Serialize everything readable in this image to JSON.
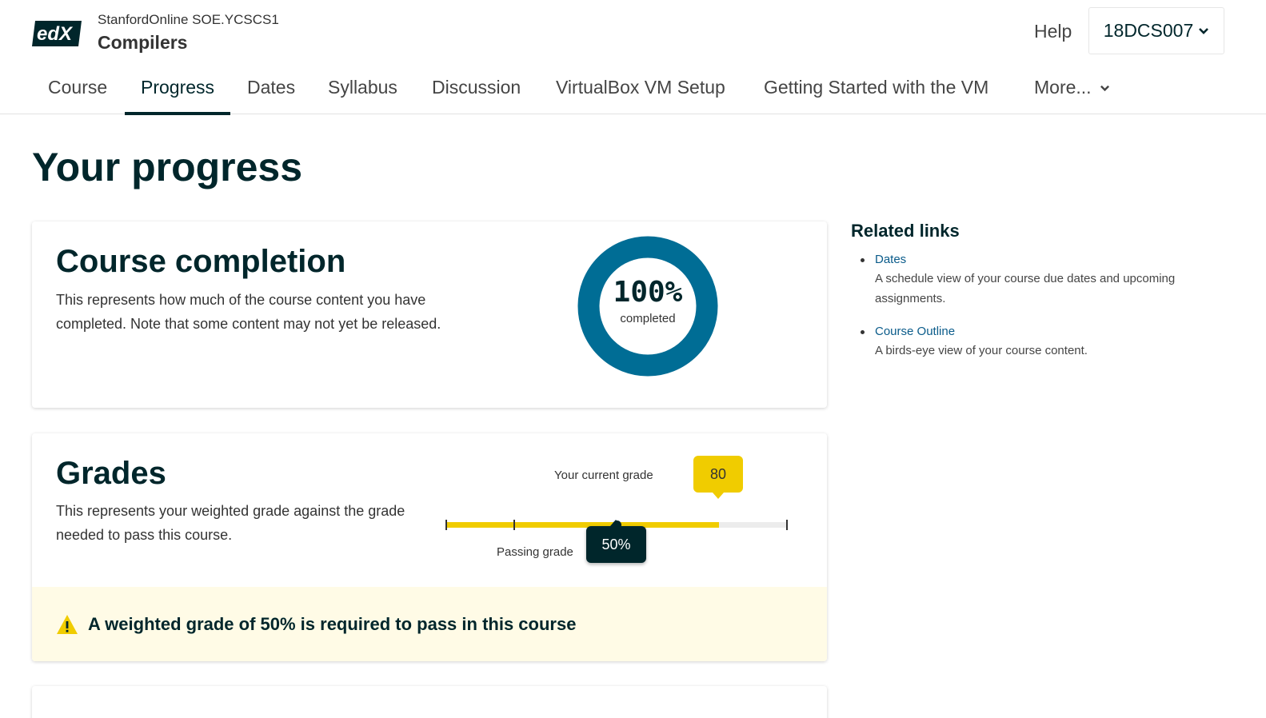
{
  "header": {
    "logo_text": "edX",
    "course_org": "StanfordOnline SOE.YCSCS1",
    "course_title": "Compilers",
    "help_label": "Help",
    "username": "18DCS007"
  },
  "nav": {
    "tabs": [
      {
        "label": "Course",
        "active": false
      },
      {
        "label": "Progress",
        "active": true
      },
      {
        "label": "Dates",
        "active": false
      },
      {
        "label": "Syllabus",
        "active": false
      },
      {
        "label": "Discussion",
        "active": false
      },
      {
        "label": "VirtualBox VM Setup",
        "active": false
      },
      {
        "label": "Getting Started with the VM",
        "active": false
      },
      {
        "label": "More...",
        "active": false
      }
    ]
  },
  "page": {
    "title": "Your progress"
  },
  "completion": {
    "heading": "Course completion",
    "description": "This represents how much of the course content you have completed. Note that some content may not yet be released.",
    "percent": 100,
    "percent_label": "100%",
    "sub_label": "completed"
  },
  "grades": {
    "heading": "Grades",
    "description": "This represents your weighted grade against the grade needed to pass this course.",
    "current_label": "Your current grade",
    "current_value": "80",
    "current_percent": 80,
    "passing_label": "Passing grade",
    "passing_value": "50%",
    "passing_percent": 50,
    "alert": "A weighted grade of 50% is required to pass in this course"
  },
  "related": {
    "heading": "Related links",
    "links": [
      {
        "label": "Dates",
        "description": "A schedule view of your course due dates and upcoming assignments."
      },
      {
        "label": "Course Outline",
        "description": "A birds-eye view of your course content."
      }
    ]
  },
  "colors": {
    "brand_dark": "#00262b",
    "donut": "#006d95",
    "grade_yellow": "#f0cc00",
    "link_blue": "#0a5b8a",
    "alert_bg": "#fffbe6"
  },
  "icons": {
    "user_menu": "chevron-down-icon",
    "more_menu": "chevron-down-icon",
    "alert": "warning-icon"
  }
}
